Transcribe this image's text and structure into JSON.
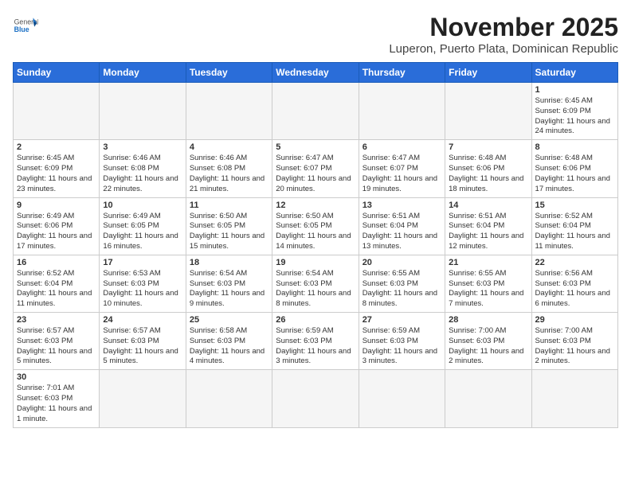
{
  "header": {
    "logo_general": "General",
    "logo_blue": "Blue",
    "month_title": "November 2025",
    "location": "Luperon, Puerto Plata, Dominican Republic"
  },
  "days_of_week": [
    "Sunday",
    "Monday",
    "Tuesday",
    "Wednesday",
    "Thursday",
    "Friday",
    "Saturday"
  ],
  "weeks": [
    [
      {
        "day": "",
        "info": ""
      },
      {
        "day": "",
        "info": ""
      },
      {
        "day": "",
        "info": ""
      },
      {
        "day": "",
        "info": ""
      },
      {
        "day": "",
        "info": ""
      },
      {
        "day": "",
        "info": ""
      },
      {
        "day": "1",
        "info": "Sunrise: 6:45 AM\nSunset: 6:09 PM\nDaylight: 11 hours\nand 24 minutes."
      }
    ],
    [
      {
        "day": "2",
        "info": "Sunrise: 6:45 AM\nSunset: 6:09 PM\nDaylight: 11 hours\nand 23 minutes."
      },
      {
        "day": "3",
        "info": "Sunrise: 6:46 AM\nSunset: 6:08 PM\nDaylight: 11 hours\nand 22 minutes."
      },
      {
        "day": "4",
        "info": "Sunrise: 6:46 AM\nSunset: 6:08 PM\nDaylight: 11 hours\nand 21 minutes."
      },
      {
        "day": "5",
        "info": "Sunrise: 6:47 AM\nSunset: 6:07 PM\nDaylight: 11 hours\nand 20 minutes."
      },
      {
        "day": "6",
        "info": "Sunrise: 6:47 AM\nSunset: 6:07 PM\nDaylight: 11 hours\nand 19 minutes."
      },
      {
        "day": "7",
        "info": "Sunrise: 6:48 AM\nSunset: 6:06 PM\nDaylight: 11 hours\nand 18 minutes."
      },
      {
        "day": "8",
        "info": "Sunrise: 6:48 AM\nSunset: 6:06 PM\nDaylight: 11 hours\nand 17 minutes."
      }
    ],
    [
      {
        "day": "9",
        "info": "Sunrise: 6:49 AM\nSunset: 6:06 PM\nDaylight: 11 hours\nand 17 minutes."
      },
      {
        "day": "10",
        "info": "Sunrise: 6:49 AM\nSunset: 6:05 PM\nDaylight: 11 hours\nand 16 minutes."
      },
      {
        "day": "11",
        "info": "Sunrise: 6:50 AM\nSunset: 6:05 PM\nDaylight: 11 hours\nand 15 minutes."
      },
      {
        "day": "12",
        "info": "Sunrise: 6:50 AM\nSunset: 6:05 PM\nDaylight: 11 hours\nand 14 minutes."
      },
      {
        "day": "13",
        "info": "Sunrise: 6:51 AM\nSunset: 6:04 PM\nDaylight: 11 hours\nand 13 minutes."
      },
      {
        "day": "14",
        "info": "Sunrise: 6:51 AM\nSunset: 6:04 PM\nDaylight: 11 hours\nand 12 minutes."
      },
      {
        "day": "15",
        "info": "Sunrise: 6:52 AM\nSunset: 6:04 PM\nDaylight: 11 hours\nand 11 minutes."
      }
    ],
    [
      {
        "day": "16",
        "info": "Sunrise: 6:52 AM\nSunset: 6:04 PM\nDaylight: 11 hours\nand 11 minutes."
      },
      {
        "day": "17",
        "info": "Sunrise: 6:53 AM\nSunset: 6:03 PM\nDaylight: 11 hours\nand 10 minutes."
      },
      {
        "day": "18",
        "info": "Sunrise: 6:54 AM\nSunset: 6:03 PM\nDaylight: 11 hours\nand 9 minutes."
      },
      {
        "day": "19",
        "info": "Sunrise: 6:54 AM\nSunset: 6:03 PM\nDaylight: 11 hours\nand 8 minutes."
      },
      {
        "day": "20",
        "info": "Sunrise: 6:55 AM\nSunset: 6:03 PM\nDaylight: 11 hours\nand 8 minutes."
      },
      {
        "day": "21",
        "info": "Sunrise: 6:55 AM\nSunset: 6:03 PM\nDaylight: 11 hours\nand 7 minutes."
      },
      {
        "day": "22",
        "info": "Sunrise: 6:56 AM\nSunset: 6:03 PM\nDaylight: 11 hours\nand 6 minutes."
      }
    ],
    [
      {
        "day": "23",
        "info": "Sunrise: 6:57 AM\nSunset: 6:03 PM\nDaylight: 11 hours\nand 5 minutes."
      },
      {
        "day": "24",
        "info": "Sunrise: 6:57 AM\nSunset: 6:03 PM\nDaylight: 11 hours\nand 5 minutes."
      },
      {
        "day": "25",
        "info": "Sunrise: 6:58 AM\nSunset: 6:03 PM\nDaylight: 11 hours\nand 4 minutes."
      },
      {
        "day": "26",
        "info": "Sunrise: 6:59 AM\nSunset: 6:03 PM\nDaylight: 11 hours\nand 3 minutes."
      },
      {
        "day": "27",
        "info": "Sunrise: 6:59 AM\nSunset: 6:03 PM\nDaylight: 11 hours\nand 3 minutes."
      },
      {
        "day": "28",
        "info": "Sunrise: 7:00 AM\nSunset: 6:03 PM\nDaylight: 11 hours\nand 2 minutes."
      },
      {
        "day": "29",
        "info": "Sunrise: 7:00 AM\nSunset: 6:03 PM\nDaylight: 11 hours\nand 2 minutes."
      }
    ],
    [
      {
        "day": "30",
        "info": "Sunrise: 7:01 AM\nSunset: 6:03 PM\nDaylight: 11 hours\nand 1 minute."
      },
      {
        "day": "",
        "info": ""
      },
      {
        "day": "",
        "info": ""
      },
      {
        "day": "",
        "info": ""
      },
      {
        "day": "",
        "info": ""
      },
      {
        "day": "",
        "info": ""
      },
      {
        "day": "",
        "info": ""
      }
    ]
  ]
}
